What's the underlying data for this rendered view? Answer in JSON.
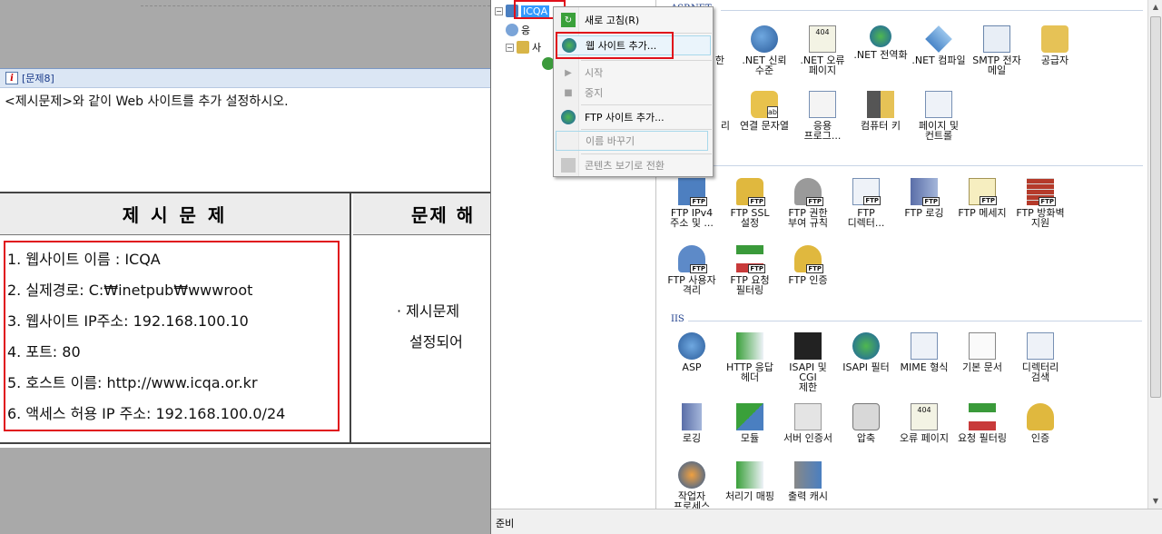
{
  "exam": {
    "question_number": "[문제8]",
    "question_icon": "i",
    "instruction": "<제시문제>와 같이 Web 사이트를 추가 설정하시오.",
    "table_header_left": "제 시 문 제",
    "table_header_right": "문제 해",
    "items": [
      "1. 웹사이트 이름 : ICQA",
      "2. 실제경로: C:₩inetpub₩wwwroot",
      "3. 웹사이트 IP주소: 192.168.100.10",
      "4. 포트: 80",
      "5. 호스트 이름: http://www.icqa.or.kr",
      "6. 액세스 허용 IP 주소: 192.168.100.0/24"
    ],
    "right_text_1": "· 제시문제",
    "right_text_2": "설정되어"
  },
  "iis": {
    "tree": {
      "root_label": "ICQA",
      "child1_label": "응",
      "child2_label": "사",
      "expand_symbol": "⊟"
    },
    "groups": {
      "aspnet": "ASP.NET",
      "iis": "IIS"
    },
    "tiles": {
      "t_a": ".NET 신뢰\n수준",
      "t_b": ".NET 오류\n페이지",
      "t_c": ".NET 전역화",
      "t_d": ".NET 컴파일",
      "t_e": "SMTP 전자\n메일",
      "t_f": "공급자",
      "t_g": "연결 문자열",
      "t_h": "응용\n프로그...",
      "t_i": "컴퓨터 키",
      "t_j": "페이지 및\n컨트롤",
      "t_k": "FTP IPv4\n주소 및 ...",
      "t_l": "FTP SSL\n설정",
      "t_m": "FTP 권한\n부여 규칙",
      "t_n": "FTP\n디렉터...",
      "t_o": "FTP 로깅",
      "t_p": "FTP 메세지",
      "t_q": "FTP 방화벽\n지원",
      "t_r": "FTP 사용자\n격리",
      "t_s": "FTP 요청\n필터링",
      "t_t": "FTP 인증",
      "t_u": "ASP",
      "t_v": "HTTP 응답\n헤더",
      "t_w": "ISAPI 및 CGI\n제한",
      "t_x": "ISAPI 필터",
      "t_y": "MIME 형식",
      "t_z": "기본 문서",
      "t_aa": "디렉터리\n검색",
      "t_ab": "로깅",
      "t_ac": "모듈",
      "t_ad": "서버 인증서",
      "t_ae": "압축",
      "t_af": "오류 페이지",
      "t_ag": "요청 필터링",
      "t_ah": "인증",
      "t_ai": "작업자\n프로세스",
      "t_aj": "처리기 매핑",
      "t_ak": "출력 캐시"
    },
    "partial_tile_1": "한",
    "partial_tile_2": "ab",
    "partial_tile_3": "리",
    "status": "준비",
    "badge": "FTP",
    "badge_404": "404"
  },
  "context_menu": {
    "refresh": "새로 고침(R)",
    "add_website": "웹 사이트 추가...",
    "start": "시작",
    "stop": "중지",
    "add_ftp": "FTP 사이트 추가...",
    "rename": "이름 바꾸기",
    "content_view": "콘텐츠 보기로 전환"
  },
  "colors": {
    "highlight_red": "#e0101a",
    "selection_blue": "#3399ff"
  }
}
